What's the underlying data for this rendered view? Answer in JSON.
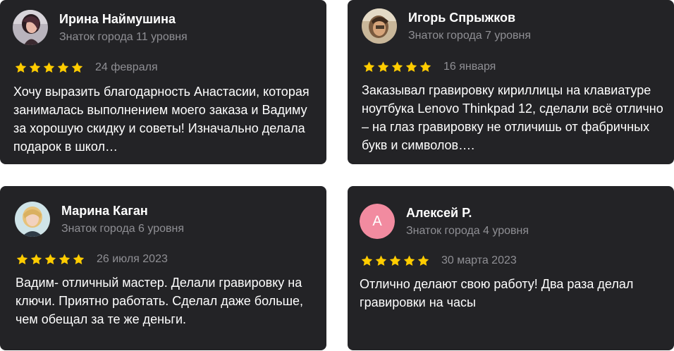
{
  "colors": {
    "card_background": "#232326",
    "star": "#ffcc00",
    "secondary_text": "#8f8f94",
    "letter_avatar": "#f28ba0"
  },
  "reviews": [
    {
      "author": "Ирина Наймушина",
      "level": "Знаток города 11 уровня",
      "rating": 5,
      "date": "24 февраля",
      "text": "Хочу выразить благодарность Анастасии, которая занималась выполнением моего заказа и Вадиму за хорошую скидку и советы! Изначально делала подарок в школ…",
      "avatar_icon": "user-photo-avatar"
    },
    {
      "author": "Игорь Спрыжков",
      "level": "Знаток города 7 уровня",
      "rating": 5,
      "date": "16 января",
      "text": "Заказывал гравировку кириллицы на клавиатуре ноутбука Lenovo Thinkpad 12, сделали всё отлично – на глаз гравировку не отличишь от фабричных букв и символов….",
      "avatar_icon": "user-photo-avatar"
    },
    {
      "author": "Марина Каган",
      "level": "Знаток города 6 уровня",
      "rating": 5,
      "date": "26 июля 2023",
      "text": "Вадим- отличный мастер. Делали гравировку на ключи. Приятно работать. Сделал даже больше, чем обещал за те же деньги.",
      "avatar_icon": "user-photo-avatar"
    },
    {
      "author": "Алексей Р.",
      "level": "Знаток города 4 уровня",
      "rating": 5,
      "date": "30 марта 2023",
      "text": "Отлично делают свою работу! Два раза делал гравировки на часы",
      "avatar_letter": "А",
      "avatar_icon": "letter-avatar"
    }
  ]
}
